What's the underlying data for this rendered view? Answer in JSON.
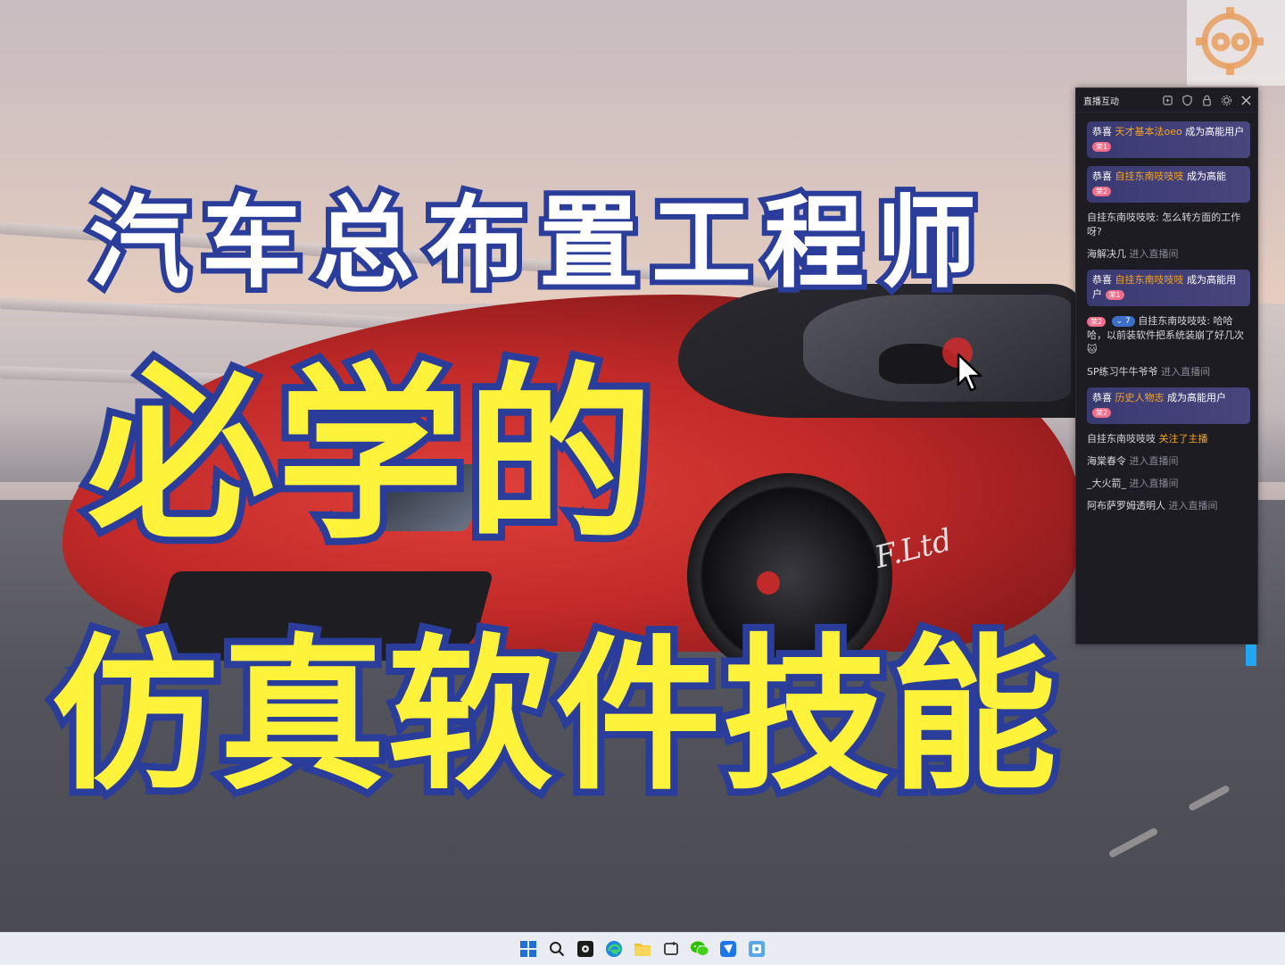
{
  "thumbnail": {
    "line1": "汽车总布置工程师",
    "line2": "必学的",
    "line3": "仿真软件技能"
  },
  "car_sign": "F.Ltd",
  "live_panel": {
    "title": "直播互动",
    "header_icons": [
      "refresh-icon",
      "shield-icon",
      "lock-icon",
      "gear-icon",
      "close-icon"
    ],
    "messages": [
      {
        "type": "card",
        "prefix": "恭喜",
        "user": "天才基本法oeo",
        "suffix": "成为高能用户",
        "badge": "荣1"
      },
      {
        "type": "card",
        "prefix": "恭喜",
        "user": "自挂东南吱吱吱",
        "suffix": "成为高能",
        "badge": "荣2"
      },
      {
        "type": "chat",
        "user": "自挂东南吱吱吱:",
        "text": "怎么转方面的工作呀?"
      },
      {
        "type": "enter",
        "user": "海解决几",
        "action": "进入直播间"
      },
      {
        "type": "card",
        "prefix": "恭喜",
        "user": "自挂东南吱吱吱",
        "suffix": "成为高能用户",
        "badge": "荣1"
      },
      {
        "type": "chat_badged",
        "badge": "荣2",
        "fan": "7",
        "user": "自挂东南吱吱吱:",
        "text": "哈哈哈，以前装软件把系统装崩了好几次"
      },
      {
        "type": "enter",
        "user": "SP练习牛牛爷爷",
        "action": "进入直播间"
      },
      {
        "type": "card",
        "prefix": "恭喜",
        "user": "历史人物志",
        "suffix": "成为高能用户",
        "badge": "荣2"
      },
      {
        "type": "follow",
        "user": "自挂东南吱吱吱",
        "action": "关注了主播"
      },
      {
        "type": "enter",
        "user": "海棠春令",
        "action": "进入直播间"
      },
      {
        "type": "enter",
        "user": "_大火箭_",
        "action": "进入直播间"
      },
      {
        "type": "enter",
        "user": "阿布萨罗姆透明人",
        "action": "进入直播间"
      }
    ]
  },
  "taskbar": {
    "icons": [
      "windows-start-icon",
      "search-icon",
      "media-player-icon",
      "edge-browser-icon",
      "file-explorer-icon",
      "screen-capture-icon",
      "wechat-icon",
      "feishu-icon",
      "app-icon"
    ]
  }
}
